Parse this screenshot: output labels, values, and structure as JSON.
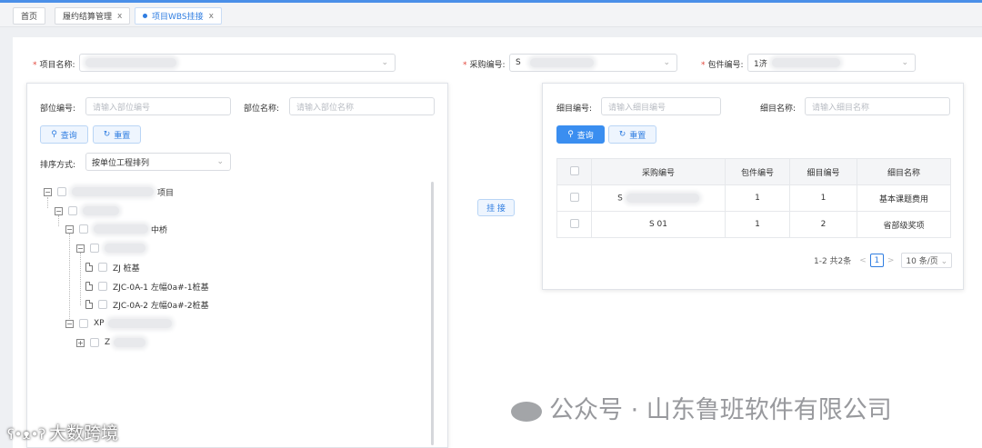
{
  "tabs": [
    {
      "label": "首页",
      "closable": false,
      "active": false
    },
    {
      "label": "履约结算管理",
      "closable": true,
      "active": false
    },
    {
      "label": "项目WBS挂接",
      "closable": true,
      "active": true
    }
  ],
  "tab_close_glyph": "x",
  "form": {
    "project_name_label": "项目名称:",
    "purchase_no_label": "采购编号:",
    "purchase_no_value": "S",
    "package_no_label": "包件编号:",
    "package_no_value": "1济"
  },
  "left_panel": {
    "part_no_label": "部位编号:",
    "part_no_placeholder": "请输入部位编号",
    "part_name_label": "部位名称:",
    "part_name_placeholder": "请输入部位名称",
    "query_button": "查询",
    "reset_button": "重置",
    "sort_label": "排序方式:",
    "sort_value": "按单位工程排列",
    "tree": [
      {
        "text": "项目",
        "level": 0,
        "expander": "−"
      },
      {
        "text": "",
        "level": 1,
        "expander": "−"
      },
      {
        "text": "中桥",
        "level": 2,
        "expander": "−"
      },
      {
        "text": "",
        "level": 3,
        "expander": "−"
      },
      {
        "text": "ZJ 桩基",
        "level": 4,
        "expander": "leaf"
      },
      {
        "text": "ZJC-0A-1 左幅0a#-1桩基",
        "level": 4,
        "expander": "leaf"
      },
      {
        "text": "ZJC-0A-2 左幅0a#-2桩基",
        "level": 4,
        "expander": "leaf"
      },
      {
        "text": "XP",
        "level": 2,
        "expander": "−"
      },
      {
        "text": "Z",
        "level": 3,
        "expander": "+"
      }
    ]
  },
  "attach_button": "挂 接",
  "right_panel": {
    "item_no_label": "细目编号:",
    "item_no_placeholder": "请输入细目编号",
    "item_name_label": "细目名称:",
    "item_name_placeholder": "请输入细目名称",
    "query_button": "查询",
    "reset_button": "重置",
    "table": {
      "headers": [
        "",
        "采购编号",
        "包件编号",
        "细目编号",
        "细目名称"
      ],
      "rows": [
        {
          "purchase_no": "S",
          "package_no": "1",
          "item_no": "1",
          "item_name": "基本课题费用"
        },
        {
          "purchase_no": "S 01",
          "package_no": "1",
          "item_no": "2",
          "item_name": "省部级奖项"
        }
      ]
    },
    "pagination": {
      "summary": "1-2 共2条",
      "prev": "<",
      "current_page": "1",
      "next": ">",
      "page_size": "10 条/页"
    }
  },
  "icons": {
    "query": "search-icon",
    "reset": "refresh-icon",
    "chevron": "chevron-down-icon"
  },
  "watermark": {
    "main": "公众号 · 山东鲁班软件有限公司",
    "corner": "大数跨境"
  },
  "colors": {
    "accent": "#2f7de1",
    "primary_button": "#3a8ef0",
    "required": "#e2483d"
  }
}
